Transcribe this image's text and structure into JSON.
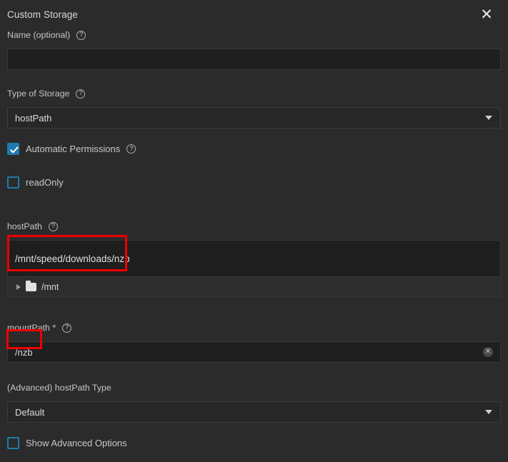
{
  "dialog": {
    "title": "Custom Storage",
    "close_icon": "close-icon",
    "close_label": "✕"
  },
  "icons": {
    "help": "?",
    "clear": "✕",
    "dropdown_arrow": "chevron-down-icon"
  },
  "fields": {
    "name": {
      "label": "Name (optional)",
      "value": "",
      "placeholder": "",
      "has_help": true
    },
    "type_of_storage": {
      "label": "Type of Storage",
      "value": "hostPath",
      "has_help": true,
      "options": [
        "hostPath"
      ]
    },
    "automatic_permissions": {
      "label": "Automatic Permissions",
      "checked": true,
      "has_help": true
    },
    "read_only": {
      "label": "readOnly",
      "checked": false,
      "has_help": false
    },
    "host_path": {
      "label": "hostPath",
      "value": "/mnt/speed/downloads/nzb",
      "has_help": true,
      "tree": [
        {
          "label": "/mnt",
          "expanded": false,
          "icon": "folder-icon"
        }
      ]
    },
    "mount_path": {
      "label": "mountPath *",
      "value": "/nzb",
      "has_help": true
    },
    "advanced_hostpath_type": {
      "label": "(Advanced) hostPath Type",
      "value": "Default",
      "has_help": false,
      "options": [
        "Default"
      ]
    },
    "show_advanced_options": {
      "label": "Show Advanced Options",
      "checked": false,
      "has_help": false
    }
  },
  "colors": {
    "background": "#2b2b2b",
    "input_background": "#1f1f1f",
    "accent_blue": "#1f7bad",
    "annotation_red": "#ef0000",
    "text": "#d4d4d4"
  }
}
